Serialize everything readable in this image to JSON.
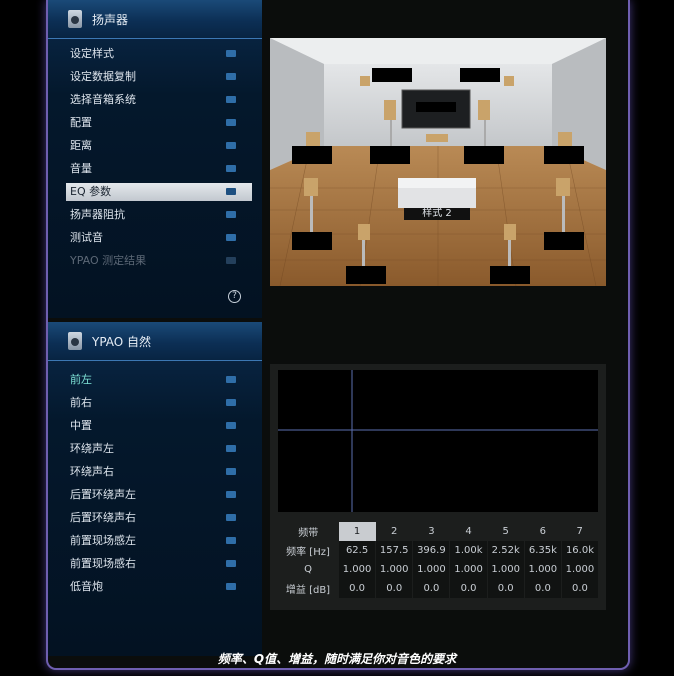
{
  "speaker_panel": {
    "title": "扬声器",
    "items": [
      {
        "label": "设定样式",
        "state": "normal"
      },
      {
        "label": "设定数据复制",
        "state": "normal"
      },
      {
        "label": "选择音箱系统",
        "state": "normal"
      },
      {
        "label": "配置",
        "state": "normal"
      },
      {
        "label": "距离",
        "state": "normal"
      },
      {
        "label": "音量",
        "state": "normal"
      },
      {
        "label": "EQ 参数",
        "state": "active"
      },
      {
        "label": "扬声器阻抗",
        "state": "normal"
      },
      {
        "label": "测试音",
        "state": "normal"
      },
      {
        "label": "YPAO 测定结果",
        "state": "disabled"
      }
    ],
    "help_symbol": "?"
  },
  "ypao_panel": {
    "title": "YPAO 自然",
    "items": [
      {
        "label": "前左",
        "state": "highlight"
      },
      {
        "label": "前右",
        "state": "normal"
      },
      {
        "label": "中置",
        "state": "normal"
      },
      {
        "label": "环绕声左",
        "state": "normal"
      },
      {
        "label": "环绕声右",
        "state": "normal"
      },
      {
        "label": "后置环绕声左",
        "state": "normal"
      },
      {
        "label": "后置环绕声右",
        "state": "normal"
      },
      {
        "label": "前置现场感左",
        "state": "normal"
      },
      {
        "label": "前置现场感右",
        "state": "normal"
      },
      {
        "label": "低音炮",
        "state": "normal"
      }
    ]
  },
  "room": {
    "pattern_label": "样式 2"
  },
  "eq": {
    "band_label": "频带",
    "freq_label": "频率 [Hz]",
    "q_label": "Q",
    "gain_label": "增益 [dB]",
    "bands": [
      "1",
      "2",
      "3",
      "4",
      "5",
      "6",
      "7"
    ],
    "selected_band_index": 0,
    "freq": [
      "62.5",
      "157.5",
      "396.9",
      "1.00k",
      "2.52k",
      "6.35k",
      "16.0k"
    ],
    "q": [
      "1.000",
      "1.000",
      "1.000",
      "1.000",
      "1.000",
      "1.000",
      "1.000"
    ],
    "gain": [
      "0.0",
      "0.0",
      "0.0",
      "0.0",
      "0.0",
      "0.0",
      "0.0"
    ]
  },
  "caption": "频率、Q值、增益，随时满足你对音色的要求",
  "colors": {
    "frame_border": "#6f5fb0",
    "panel_bg": "#04182c",
    "active_item_bg": "#c2c8cf",
    "highlight_text": "#7fe4d8"
  }
}
